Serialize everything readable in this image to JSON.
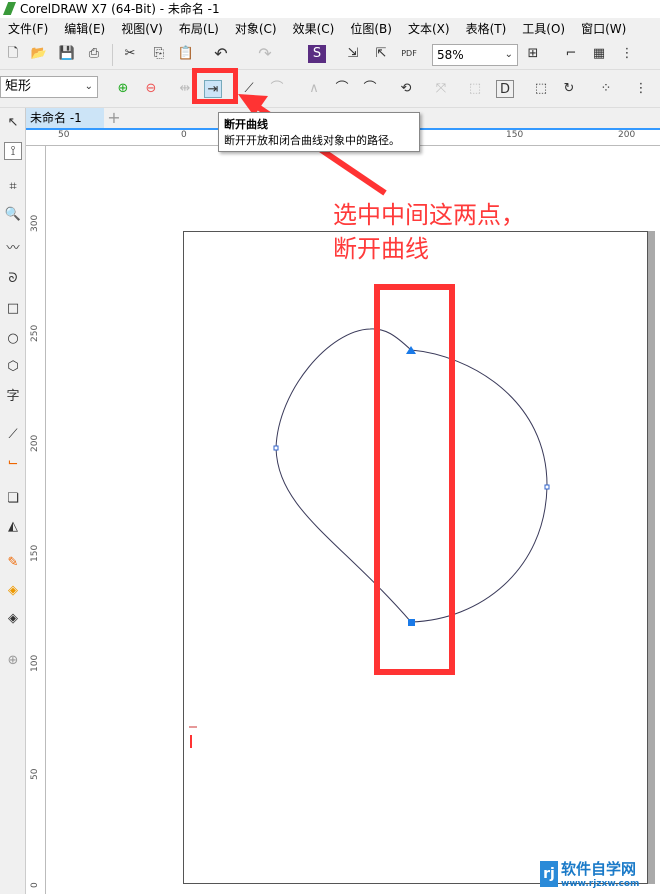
{
  "window": {
    "title": "CorelDRAW X7 (64-Bit) - 未命名 -1"
  },
  "menu": [
    "文件(F)",
    "编辑(E)",
    "视图(V)",
    "布局(L)",
    "对象(C)",
    "效果(C)",
    "位图(B)",
    "文本(X)",
    "表格(T)",
    "工具(O)",
    "窗口(W)"
  ],
  "toolbar": {
    "zoom": "58%"
  },
  "property_bar": {
    "shape_type": "矩形"
  },
  "tabs": {
    "doc": "未命名 -1",
    "add": "+"
  },
  "ruler": {
    "top": [
      "50",
      "0",
      "150",
      "200"
    ],
    "left": [
      "300",
      "250",
      "200",
      "150",
      "100",
      "50",
      "0"
    ]
  },
  "tooltip": {
    "title": "断开曲线",
    "desc": "断开开放和闭合曲线对象中的路径。"
  },
  "annotation": {
    "line1": "选中中间这两点，",
    "line2": "断开曲线"
  },
  "watermark": {
    "brand": "软件自学网",
    "url": "www.rjzxw.com"
  },
  "colors": {
    "annotation": "#ff3a3a",
    "selection": "#3399ff"
  }
}
